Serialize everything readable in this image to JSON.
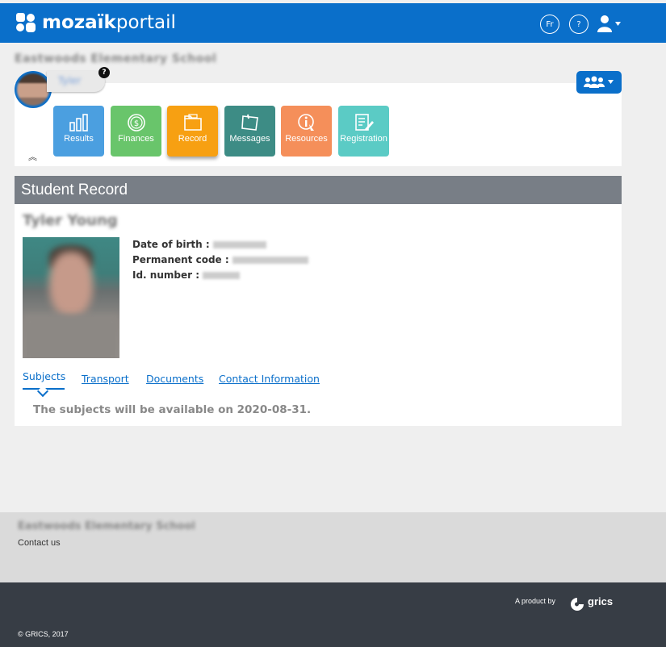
{
  "header": {
    "logo_bold": "mozaïk",
    "logo_light": "portail",
    "lang_button": "Fr",
    "help_button": "?"
  },
  "school": {
    "name": "Eastwoods Elementary School"
  },
  "student_chip": {
    "name": "Tyler",
    "help_badge": "?"
  },
  "tiles": [
    {
      "label": "Results",
      "color": "#4b9fe0",
      "icon": "bar-chart-icon"
    },
    {
      "label": "Finances",
      "color": "#69c56b",
      "icon": "dollar-coin-icon"
    },
    {
      "label": "Record",
      "color": "#f7a012",
      "icon": "folder-icon",
      "active": true
    },
    {
      "label": "Messages",
      "color": "#3d8c85",
      "icon": "message-icon"
    },
    {
      "label": "Resources",
      "color": "#f58f5a",
      "icon": "info-hand-icon"
    },
    {
      "label": "Registration",
      "color": "#5bcbc5",
      "icon": "form-pen-icon"
    }
  ],
  "record": {
    "section_title": "Student Record",
    "student_name": "Tyler Young",
    "fields": {
      "dob_label": "Date of birth :",
      "code_label": "Permanent code :",
      "id_label": "Id. number :"
    },
    "tabs": [
      "Subjects",
      "Transport",
      "Documents",
      "Contact Information"
    ],
    "active_tab": "Subjects",
    "message": "The subjects will be available on 2020-08-31."
  },
  "footer": {
    "school_name": "Eastwoods Elementary School",
    "contact": "Contact us",
    "product_by": "A product by",
    "brand": "grics",
    "copyright": "© GRICS, 2017"
  }
}
